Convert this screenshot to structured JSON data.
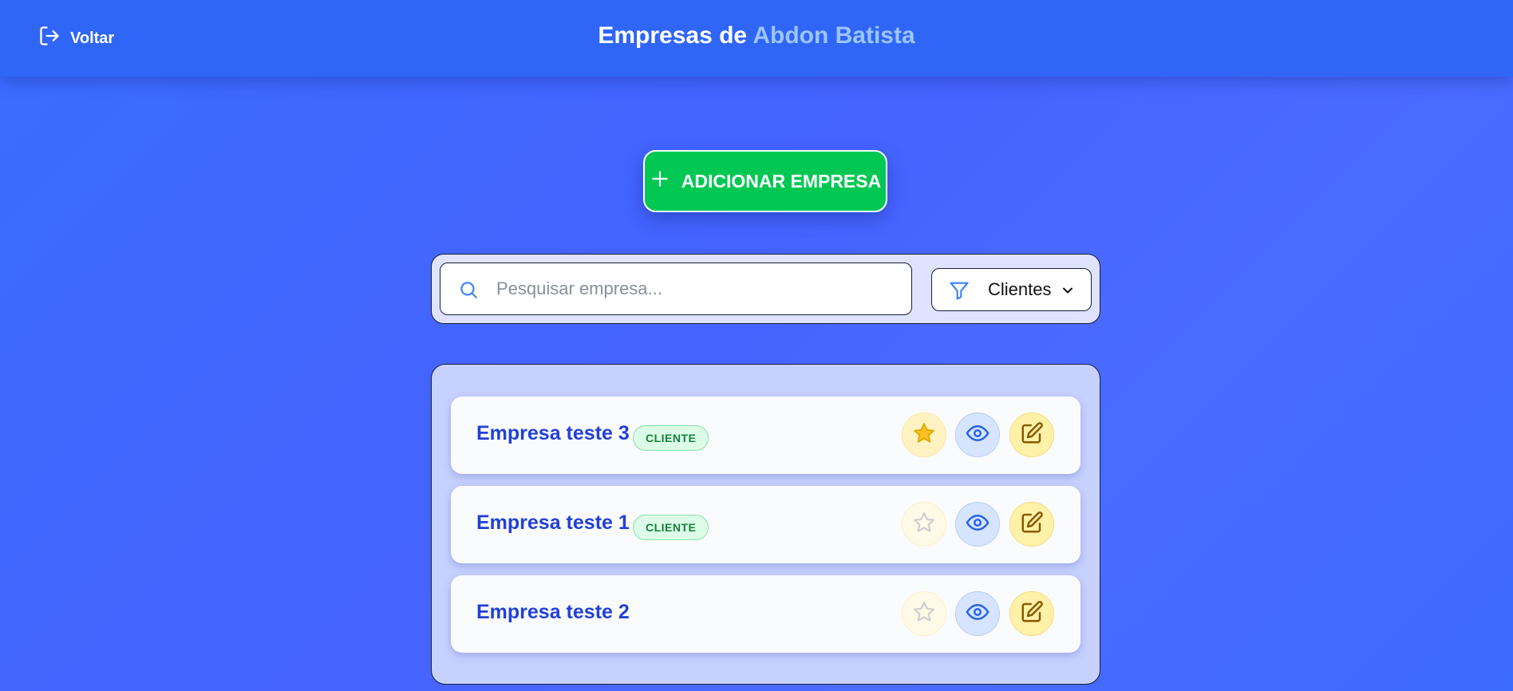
{
  "header": {
    "back_label": "Voltar",
    "title_prefix": "Empresas de ",
    "title_name": "Abdon Batista"
  },
  "actions": {
    "add_label": "ADICIONAR EMPRESA"
  },
  "search": {
    "placeholder": "Pesquisar empresa...",
    "value": ""
  },
  "filter": {
    "selected": "Clientes"
  },
  "companies": [
    {
      "name": "Empresa teste 3",
      "badge": "CLIENTE",
      "favorite": true
    },
    {
      "name": "Empresa teste 1",
      "badge": "CLIENTE",
      "favorite": false
    },
    {
      "name": "Empresa teste 2",
      "badge": "",
      "favorite": false
    }
  ],
  "icons": {
    "back": "logout-icon",
    "add": "plus-icon",
    "search": "search-icon",
    "filter": "funnel-icon",
    "dropdown": "chevron-down-icon",
    "favorite": "star-icon",
    "view": "eye-icon",
    "edit": "edit-icon"
  },
  "colors": {
    "header_bg": "#2f66f8",
    "title_accent": "#9cc4ff",
    "add_button": "#00c853",
    "company_name": "#2140d8",
    "badge_text": "#15803d",
    "star_active": "#fbbf24"
  }
}
